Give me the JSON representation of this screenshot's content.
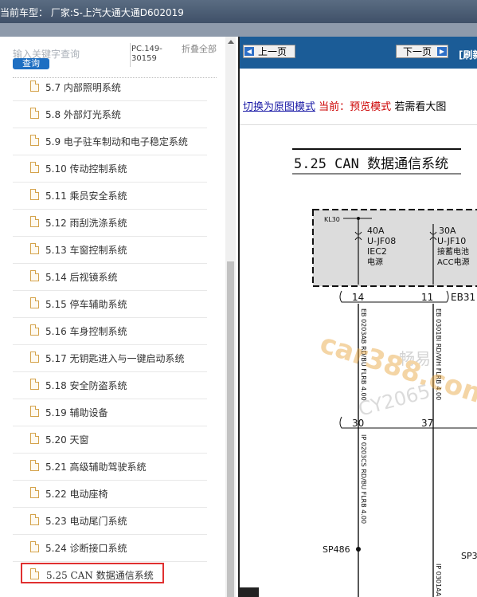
{
  "window": {
    "title": "当前车型： 厂家:S-上汽大通大通D602019"
  },
  "search": {
    "placeholder": "输入关键字查询",
    "button_label": "查询",
    "code": "PC.149-30159",
    "fold_label": "折叠全部"
  },
  "tree": {
    "items": [
      {
        "label": "5.7 内部照明系统"
      },
      {
        "label": "5.8 外部灯光系统"
      },
      {
        "label": "5.9 电子驻车制动和电子稳定系统"
      },
      {
        "label": "5.10 传动控制系统"
      },
      {
        "label": "5.11 乘员安全系统"
      },
      {
        "label": "5.12 雨刮洗涤系统"
      },
      {
        "label": "5.13 车窗控制系统"
      },
      {
        "label": "5.14 后视镜系统"
      },
      {
        "label": "5.15 停车辅助系统"
      },
      {
        "label": "5.16 车身控制系统"
      },
      {
        "label": "5.17 无钥匙进入与一键启动系统"
      },
      {
        "label": "5.18 安全防盗系统"
      },
      {
        "label": "5.19 辅助设备"
      },
      {
        "label": "5.20 天窗"
      },
      {
        "label": "5.21 高级辅助驾驶系统"
      },
      {
        "label": "5.22 电动座椅"
      },
      {
        "label": "5.23 电动尾门系统"
      },
      {
        "label": "5.24 诊断接口系统"
      },
      {
        "label": "5.25 CAN 数据通信系统"
      }
    ]
  },
  "toolbar": {
    "prev_label": "上一页",
    "next_label": "下一页",
    "refresh_label": "[刷新"
  },
  "mode": {
    "switch_link": "切换为原图模式",
    "current": "当前：预览模式",
    "hint": "若需看大图"
  },
  "diagram": {
    "title": "5.25 CAN 数据通信系统",
    "kl30": "KL30",
    "fuse1": {
      "rating": "40A",
      "id": "U-JF08",
      "line3": "IEC2",
      "line4": "电源"
    },
    "fuse2": {
      "rating": "30A",
      "id": "U-JF10",
      "line3": "接蓄电池",
      "line4": "ACC电源"
    },
    "pin_a": "14",
    "pin_b": "11",
    "connector_top": "EB31",
    "wire1": "EB 0203AB RD/BU FLRB 4.00",
    "wire2": "EB 0301BI RD/WH FLRB 4.00",
    "pin_c": "30",
    "pin_d": "37",
    "wire3": "IP 0203CS RD/BU FLRB 4.00",
    "wire4": "IP 0301AA",
    "splice1": "SP486",
    "splice2": "SP3",
    "watermark1": "畅易",
    "watermark2": "car388.com",
    "watermark3": "CY2065",
    "accent_color": "#1b5c97"
  }
}
